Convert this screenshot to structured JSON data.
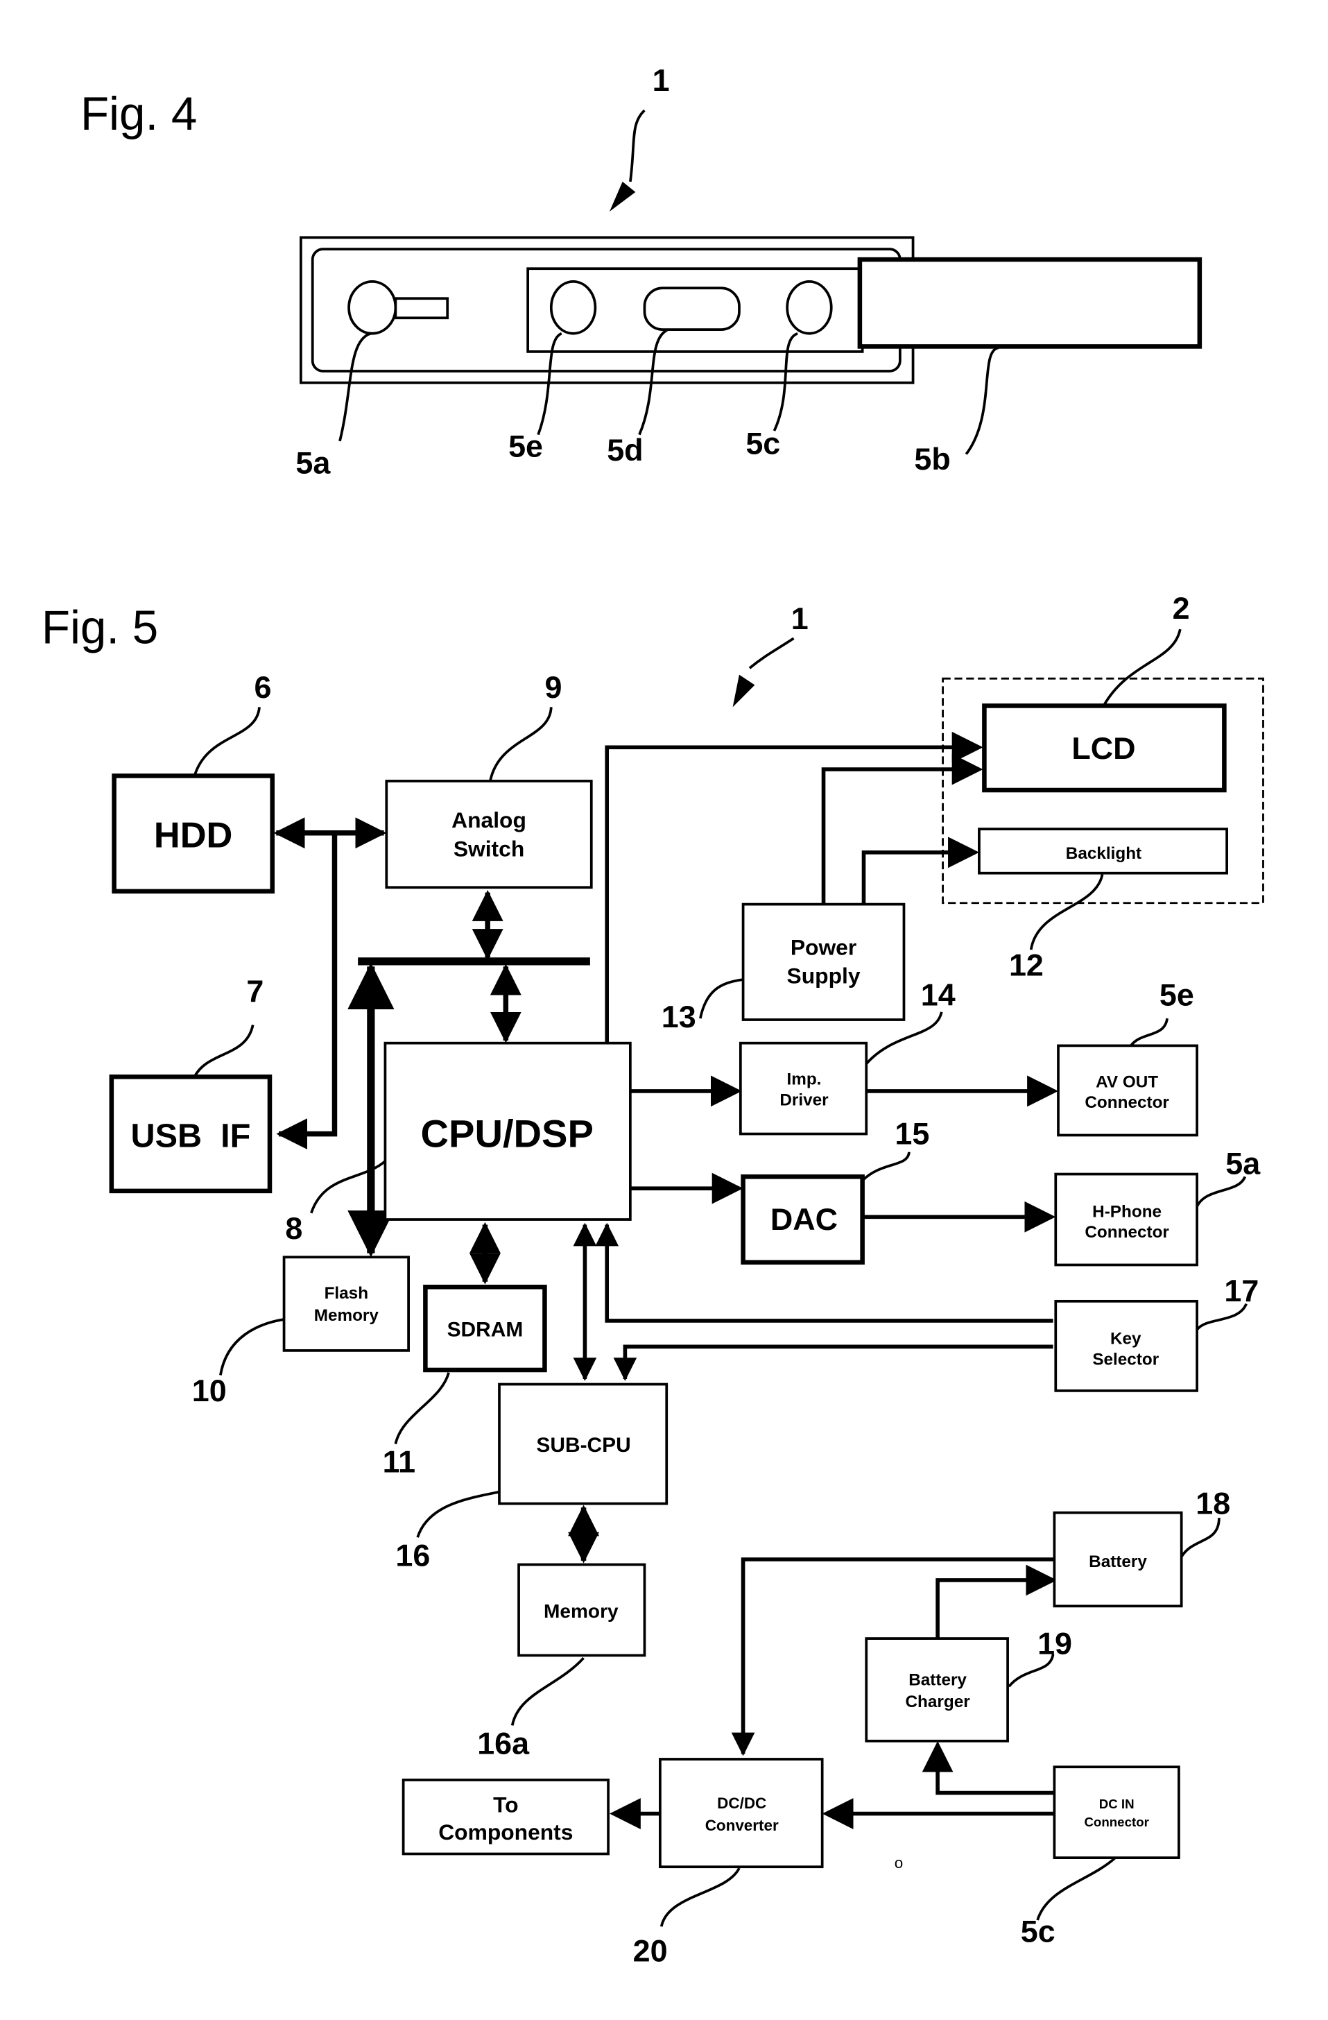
{
  "fig4": {
    "title": "Fig. 4",
    "device_ref": "1",
    "refs": {
      "a": "5a",
      "e": "5e",
      "d": "5d",
      "c": "5c",
      "b": "5b"
    }
  },
  "fig5": {
    "title": "Fig. 5",
    "device_ref": "1",
    "blocks": {
      "hdd": {
        "label": "HDD",
        "ref": "6"
      },
      "usb": {
        "label": "USB  IF",
        "ref": "7"
      },
      "analog": {
        "line1": "Analog",
        "line2": "Switch",
        "ref": "9"
      },
      "cpu": {
        "label": "CPU/DSP",
        "ref": "8"
      },
      "flash": {
        "line1": "Flash",
        "line2": "Memory",
        "ref": "10"
      },
      "sdram": {
        "label": "SDRAM",
        "ref": "11"
      },
      "lcd": {
        "label": "LCD",
        "ref": "2"
      },
      "backlight": {
        "label": "Backlight",
        "ref": "12"
      },
      "power": {
        "line1": "Power",
        "line2": "Supply",
        "ref": "13"
      },
      "imp": {
        "line1": "Imp.",
        "line2": "Driver",
        "ref": "14"
      },
      "dac": {
        "label": "DAC",
        "ref": "15"
      },
      "avout": {
        "line1": "AV OUT",
        "line2": "Connector",
        "ref": "5e"
      },
      "hphone": {
        "line1": "H-Phone",
        "line2": "Connector",
        "ref": "5a"
      },
      "key": {
        "line1": "Key",
        "line2": "Selector",
        "ref": "17"
      },
      "subcpu": {
        "label": "SUB-CPU",
        "ref": "16"
      },
      "memory": {
        "label": "Memory",
        "ref": "16a"
      },
      "battery": {
        "label": "Battery",
        "ref": "18"
      },
      "charger": {
        "line1": "Battery",
        "line2": "Charger",
        "ref": "19"
      },
      "dcdc": {
        "line1": "DC/DC",
        "line2": "Converter",
        "ref": "20"
      },
      "dcin": {
        "line1": "DC IN",
        "line2": "Connector",
        "ref": "5c"
      },
      "to": {
        "line1": "To",
        "line2": "Components"
      }
    },
    "stray_mark": "o"
  }
}
